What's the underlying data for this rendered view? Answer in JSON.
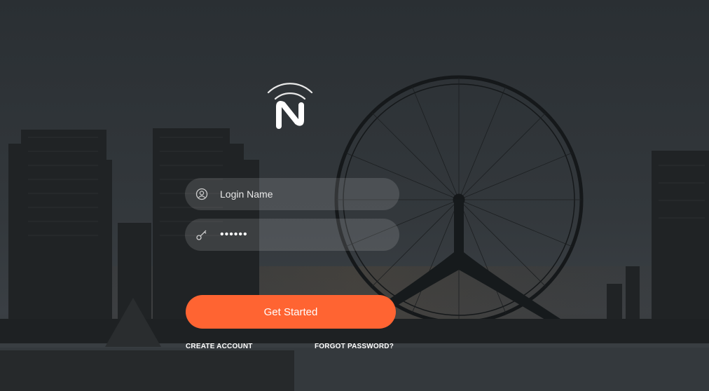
{
  "brand": {
    "logo_icon": "wifi-n-logo-icon",
    "accent": "#ff6432"
  },
  "form": {
    "username": {
      "placeholder": "Login Name",
      "value": "",
      "icon": "user-circle-icon"
    },
    "password": {
      "value": "••••••",
      "icon": "key-icon"
    },
    "submit_label": "Get Started"
  },
  "links": {
    "create_account": "CREATE ACCOUNT",
    "forgot_password": "FORGOT PASSWORD?"
  }
}
